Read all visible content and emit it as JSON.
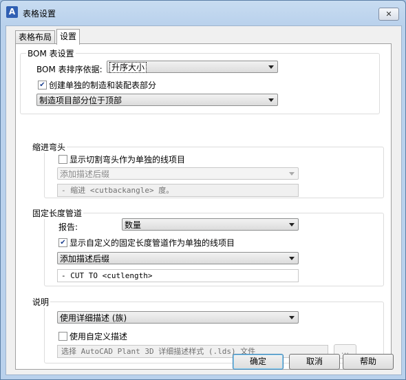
{
  "window": {
    "title": "表格设置",
    "icon": "autocad-a-icon",
    "close": "✕"
  },
  "tabs": [
    {
      "label": "表格布局",
      "active": false
    },
    {
      "label": "设置",
      "active": true
    }
  ],
  "bom": {
    "group_label": "BOM 表设置",
    "sort_label": "BOM 表排序依据:",
    "sort_value": "升序大小",
    "separate_checkbox": {
      "label": "创建单独的制造和装配表部分",
      "checked": true
    },
    "position_value": "制造项目部分位于顶部"
  },
  "miter": {
    "group_label": "缩进弯头",
    "checkbox": {
      "label": "显示切割弯头作为单独的线项目",
      "checked": false
    },
    "suffix_value": "添加描述后缀",
    "text_value": "- 缩进 <cutbackangle> 度。"
  },
  "fixed_pipe": {
    "group_label": "固定长度管道",
    "report_label": "报告:",
    "report_value": "数量",
    "checkbox": {
      "label": "显示自定义的固定长度管道作为单独的线项目",
      "checked": true
    },
    "suffix_value": "添加描述后缀",
    "text_value": "- CUT TO <cutlength>"
  },
  "description": {
    "group_label": "说明",
    "mode_value": "使用详细描述 (族)",
    "checkbox": {
      "label": "使用自定义描述",
      "checked": false
    },
    "file_value": "选择 AutoCAD Plant 3D 详细描述样式 (.lds) 文件",
    "browse": "..."
  },
  "buttons": {
    "ok": "确定",
    "cancel": "取消",
    "help": "帮助"
  }
}
